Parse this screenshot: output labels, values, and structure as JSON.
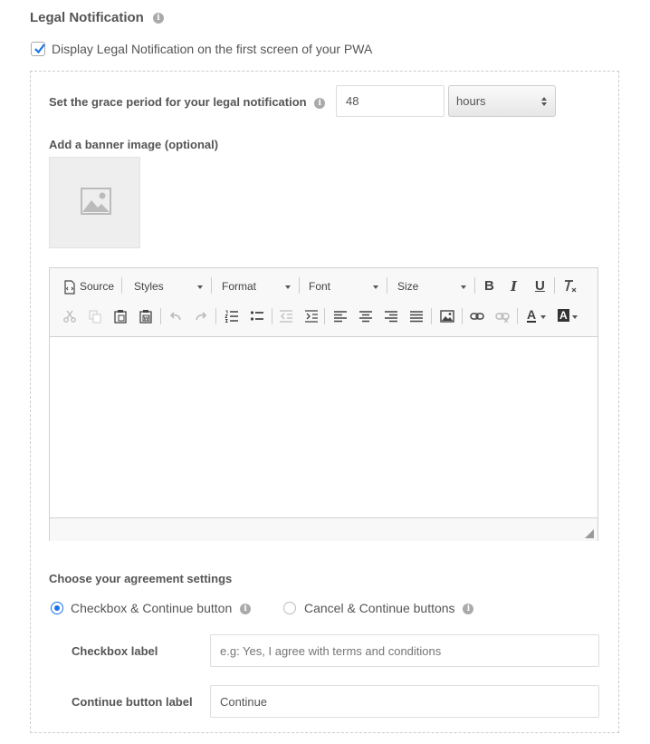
{
  "section": {
    "title": "Legal Notification",
    "info_glyph": "i"
  },
  "display_checkbox": {
    "label": "Display Legal Notification on the first screen of your PWA",
    "checked": true
  },
  "grace": {
    "label": "Set the grace period for your legal notification",
    "value": "48",
    "unit": "hours"
  },
  "banner": {
    "label": "Add a banner image (optional)",
    "icon": "image-placeholder-icon"
  },
  "editor": {
    "source_label": "Source",
    "styles_label": "Styles",
    "format_label": "Format",
    "font_label": "Font",
    "size_label": "Size",
    "bold": "B",
    "italic": "I",
    "underline": "U",
    "font_color_glyph": "A",
    "bg_color_glyph": "A"
  },
  "agreement": {
    "heading": "Choose your agreement settings",
    "options": [
      {
        "label": "Checkbox & Continue button",
        "selected": true
      },
      {
        "label": "Cancel & Continue buttons",
        "selected": false
      }
    ],
    "checkbox_label_title": "Checkbox label",
    "checkbox_label_placeholder": "e.g: Yes, I agree with terms and conditions",
    "continue_label_title": "Continue button label",
    "continue_label_value": "Continue"
  },
  "colors": {
    "accent": "#1a73e8",
    "text": "#555555"
  }
}
